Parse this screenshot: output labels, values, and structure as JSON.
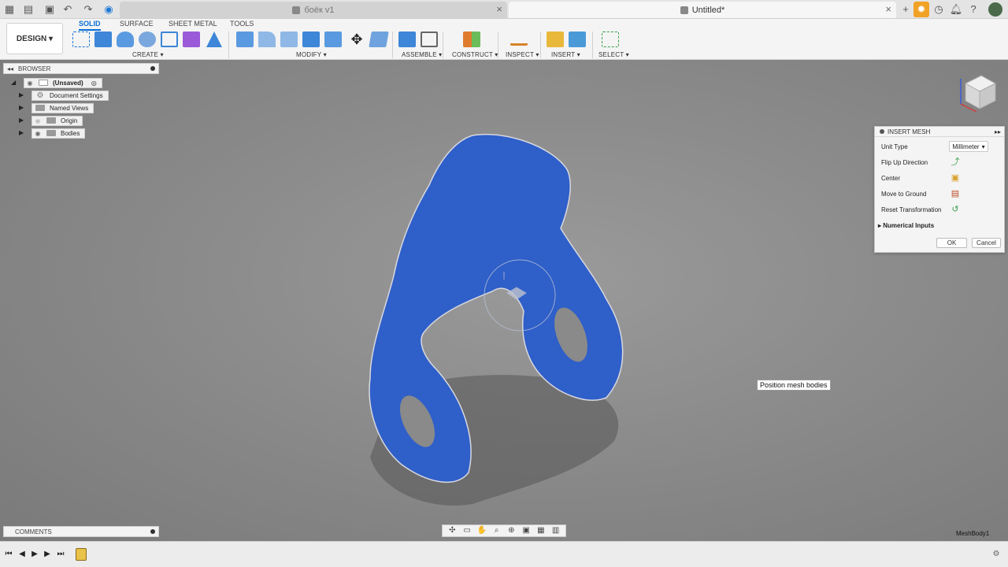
{
  "tabs": {
    "inactive_title": "боёк v1",
    "active_title": "Untitled*",
    "close_glyph": "×",
    "new_tab_glyph": "+"
  },
  "toolbar": {
    "workspace": "DESIGN ▾",
    "modes": [
      "SOLID",
      "SURFACE",
      "SHEET METAL",
      "TOOLS"
    ],
    "groups": {
      "create": "CREATE ▾",
      "modify": "MODIFY ▾",
      "assemble": "ASSEMBLE ▾",
      "construct": "CONSTRUCT ▾",
      "inspect": "INSPECT ▾",
      "insert": "INSERT ▾",
      "select": "SELECT ▾"
    }
  },
  "browser": {
    "title": "BROWSER",
    "root": "(Unsaved)",
    "items": [
      "Document Settings",
      "Named Views",
      "Origin",
      "Bodies"
    ]
  },
  "comments": {
    "title": "COMMENTS"
  },
  "dialog": {
    "title": "INSERT MESH",
    "unit_type_label": "Unit Type",
    "unit_type_value": "Millimeter",
    "flip_label": "Flip Up Direction",
    "center_label": "Center",
    "ground_label": "Move to Ground",
    "reset_label": "Reset Transformation",
    "numerical_label": "Numerical Inputs",
    "ok": "OK",
    "cancel": "Cancel"
  },
  "tooltip": "Position mesh bodies",
  "status": {
    "mesh_body": "MeshBody1"
  },
  "colors": {
    "accent": "#0a6fd6",
    "mesh": "#2f5fc8",
    "orange": "#f1a225"
  }
}
